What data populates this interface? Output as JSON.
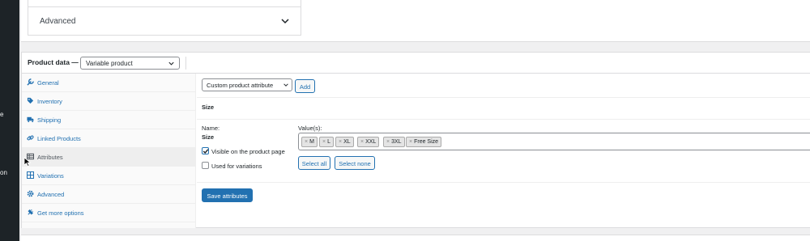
{
  "admin_bar": {
    "label1": "e",
    "label2": "on"
  },
  "top_panel": {
    "advanced_label": "Advanced"
  },
  "product_data": {
    "title": "Product data —",
    "type_selected": "Variable product",
    "tabs": [
      {
        "label": "General",
        "icon": "wrench-icon"
      },
      {
        "label": "Inventory",
        "icon": "tag-icon"
      },
      {
        "label": "Shipping",
        "icon": "truck-icon"
      },
      {
        "label": "Linked Products",
        "icon": "link-icon"
      },
      {
        "label": "Attributes",
        "icon": "table-icon",
        "active": true
      },
      {
        "label": "Variations",
        "icon": "grid-icon"
      },
      {
        "label": "Advanced",
        "icon": "gear-icon"
      },
      {
        "label": "Get more options",
        "icon": "plugin-icon"
      }
    ]
  },
  "attributes_panel": {
    "attribute_select": "Custom product attribute",
    "add_button": "Add",
    "attribute_title": "Size",
    "name_label": "Name:",
    "name_value": "Size",
    "values_label": "Value(s):",
    "values": [
      "M",
      "L",
      "XL",
      "XXL",
      "3XL",
      "Free Size"
    ],
    "visible_label": "Visible on the product page",
    "visible_checked": true,
    "variations_label": "Used for variations",
    "variations_checked": false,
    "select_all": "Select all",
    "select_none": "Select none",
    "save_button": "Save attributes"
  },
  "colors": {
    "accent": "#2271b1",
    "admin_bar": "#1d2327"
  }
}
